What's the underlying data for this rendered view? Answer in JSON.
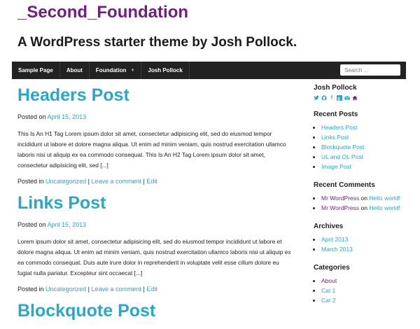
{
  "site": {
    "title": "_Second_Foundation",
    "description": "A WordPress starter theme by Josh Pollock."
  },
  "nav": {
    "items": [
      "Sample Page",
      "About",
      "Foundation",
      "Josh Pollock"
    ],
    "dropdown_icon": "caret-down-icon"
  },
  "search": {
    "placeholder": "Search ..."
  },
  "posts": [
    {
      "title": "Headers Post",
      "posted_on_label": "Posted on",
      "date": "April 15, 2013",
      "excerpt": "This Is An H1 Tag Lorem ipsum dolor sit amet, consectetur adipisicing elit, sed do eiusmod tempor incididunt ut labore et dolore magna aliqua. Ut enim ad minim veniam, quis nostrud exercitation ullamco laboris nisi ut aliquip ex ea commodo consequat. This Is An H2 Tag Lorem ipsum dolor sit amet, consectetur adipisicing elit, sed [...]",
      "posted_in_label": "Posted in",
      "category": "Uncategorized",
      "sep1": "|",
      "comment_link": "Leave a comment",
      "sep2": "|",
      "edit_link": "Edit"
    },
    {
      "title": "Links Post",
      "posted_on_label": "Posted on",
      "date": "April 15, 2013",
      "excerpt": "Lorem ipsum dolor sit amet, consectetur adipisicing elit, sed do eiusmod tempor incididunt ut labore et dolore magna aliqua. Ut enim ad minim veniam, quis nostrud exercitation ullamco laboris nisi ut aliquip ex ea commodo consequat. Duis aute irure dolor in reprehenderit in voluptate velit esse cillum dolore eu fugiat nulla pariatur. Excepteur sint occaecat [...]",
      "posted_in_label": "Posted in",
      "category": "Uncategorized",
      "sep1": "|",
      "comment_link": "Leave a comment",
      "sep2": "|",
      "edit_link": "Edit"
    },
    {
      "title": "Blockquote Post"
    }
  ],
  "sidebar": {
    "author": {
      "title": "Josh Pollock",
      "social_icons": [
        "twitter-icon",
        "github-icon",
        "tumblr-icon",
        "google-plus-icon",
        "email-icon",
        "home-icon"
      ]
    },
    "recent_posts": {
      "title": "Recent Posts",
      "items": [
        "Headers Post",
        "Links Post",
        "Blockquote Post",
        "UL and OL Post",
        "Image Post"
      ]
    },
    "recent_comments": {
      "title": "Recent Comments",
      "items": [
        {
          "author": "Mr WordPress",
          "on": "on",
          "post": "Hello world!"
        },
        {
          "author": "Mr WordPress",
          "on": "on",
          "post": "Hello world!"
        }
      ]
    },
    "archives": {
      "title": "Archives",
      "items": [
        "April 2013",
        "March 2013"
      ]
    },
    "categories": {
      "title": "Categories",
      "items": [
        "About",
        "Cat 1",
        "Cat 2"
      ]
    }
  },
  "colors": {
    "link": "#2ba6cb",
    "visited": "#6f1f7c",
    "topbar": "#222222"
  }
}
